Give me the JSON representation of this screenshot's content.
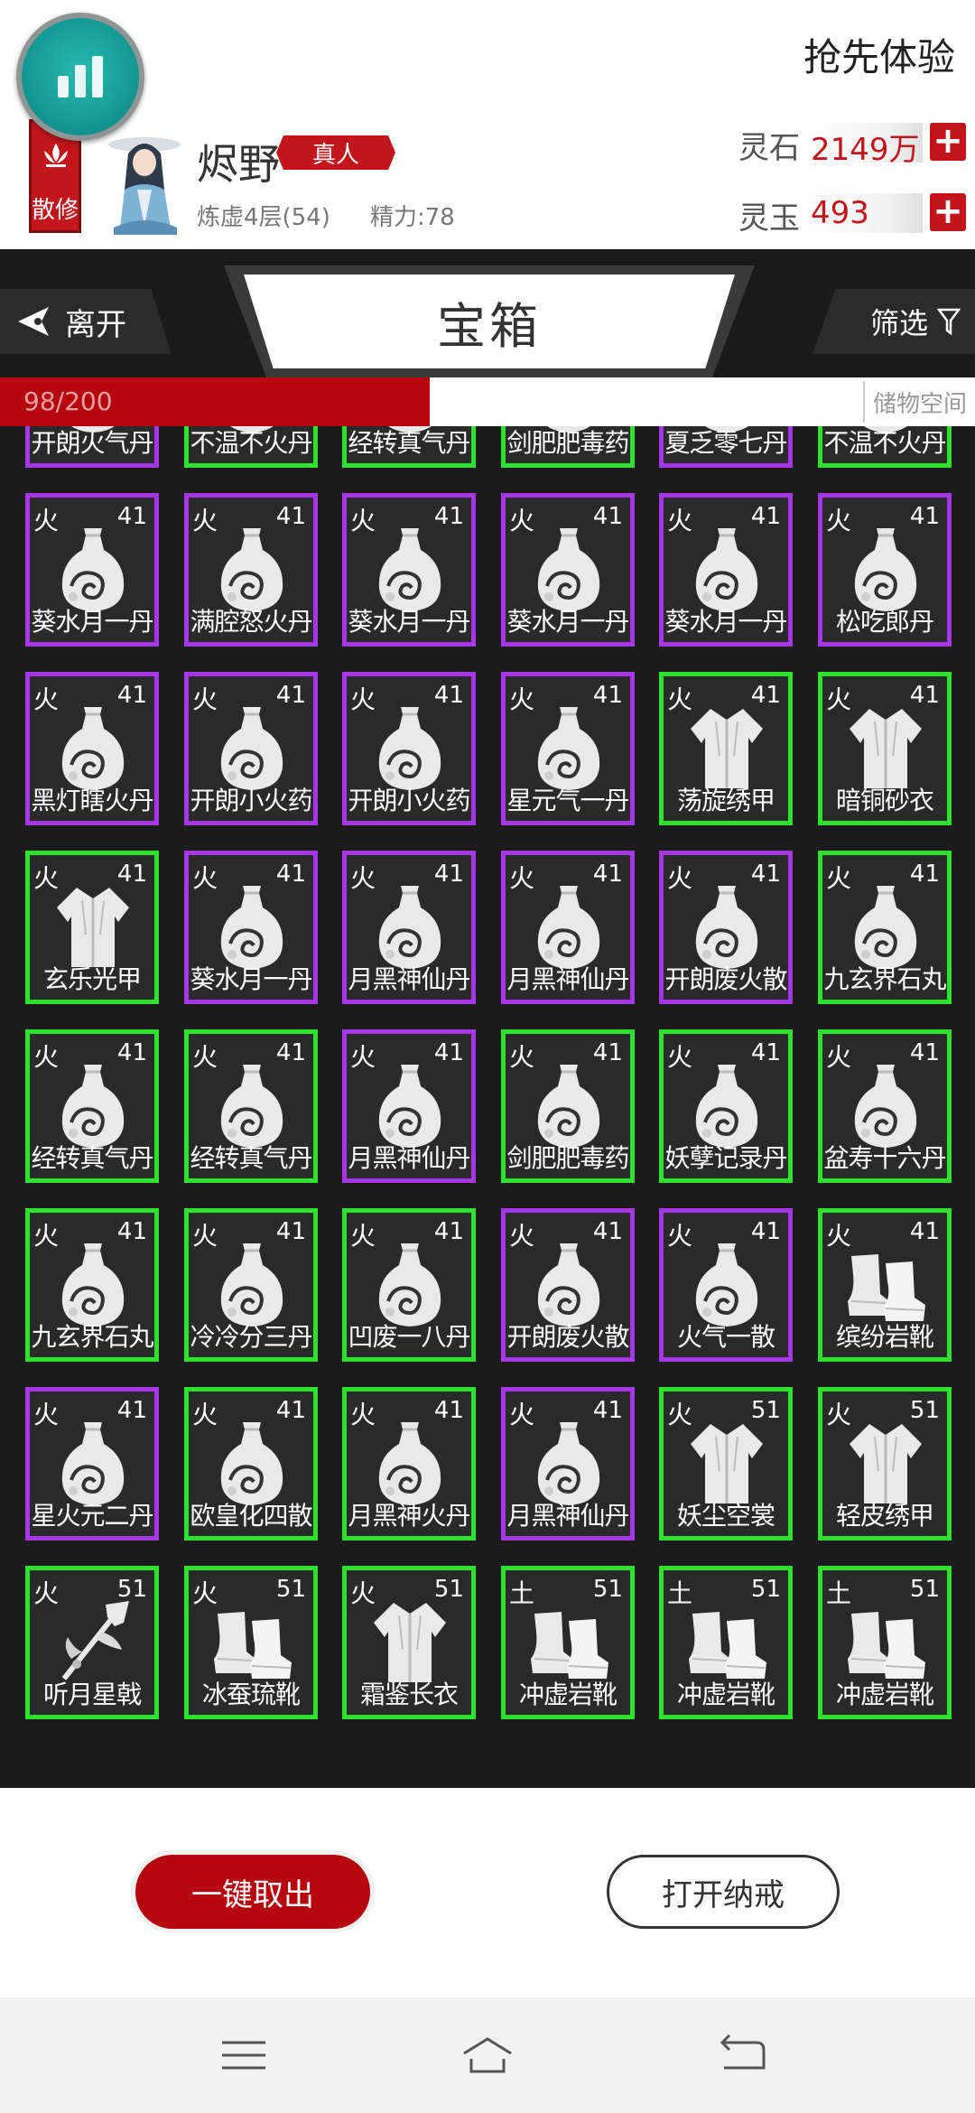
{
  "header": {
    "early_access": "抢先体验",
    "sect_badge": "散修",
    "player": {
      "name": "烬野",
      "realm_tag": "真人",
      "realm_level": "炼虚4层(54)",
      "stamina": "精力:78"
    },
    "currencies": [
      {
        "label": "灵石",
        "value": "2149万",
        "add": "+"
      },
      {
        "label": "灵玉",
        "value": "493",
        "add": "+"
      }
    ]
  },
  "tabs": {
    "leave": "离开",
    "title": "宝箱",
    "filter": "筛选"
  },
  "capacity": {
    "count": "98/200",
    "used": 98,
    "total": 200,
    "storage_label": "储物空间"
  },
  "colors": {
    "accent_red": "#b5070d",
    "rare_green": "#2fe12f",
    "epic_purple": "#a637e8"
  },
  "items": [
    {
      "elem": "",
      "lvl": "",
      "name": "开朗火气丹",
      "rarity": "purple",
      "icon": "pill-bottle-icon"
    },
    {
      "elem": "",
      "lvl": "",
      "name": "不温不火丹",
      "rarity": "green",
      "icon": "pill-bottle-icon"
    },
    {
      "elem": "",
      "lvl": "",
      "name": "经转真气丹",
      "rarity": "green",
      "icon": "pill-bottle-icon"
    },
    {
      "elem": "",
      "lvl": "",
      "name": "剑肥肥毒药",
      "rarity": "green",
      "icon": "pill-bottle-icon"
    },
    {
      "elem": "",
      "lvl": "",
      "name": "夏乏零七丹",
      "rarity": "purple",
      "icon": "pill-bottle-icon"
    },
    {
      "elem": "",
      "lvl": "",
      "name": "不温不火丹",
      "rarity": "green",
      "icon": "pill-bottle-icon"
    },
    {
      "elem": "火",
      "lvl": "41",
      "name": "葵水月一丹",
      "rarity": "purple",
      "icon": "pill-bottle-icon"
    },
    {
      "elem": "火",
      "lvl": "41",
      "name": "满腔怒火丹",
      "rarity": "purple",
      "icon": "pill-bottle-icon"
    },
    {
      "elem": "火",
      "lvl": "41",
      "name": "葵水月一丹",
      "rarity": "purple",
      "icon": "pill-bottle-icon"
    },
    {
      "elem": "火",
      "lvl": "41",
      "name": "葵水月一丹",
      "rarity": "purple",
      "icon": "pill-bottle-icon"
    },
    {
      "elem": "火",
      "lvl": "41",
      "name": "葵水月一丹",
      "rarity": "purple",
      "icon": "pill-bottle-icon"
    },
    {
      "elem": "火",
      "lvl": "41",
      "name": "松吃郎丹",
      "rarity": "purple",
      "icon": "pill-bottle-icon"
    },
    {
      "elem": "火",
      "lvl": "41",
      "name": "黑灯瞎火丹",
      "rarity": "purple",
      "icon": "pill-bottle-icon"
    },
    {
      "elem": "火",
      "lvl": "41",
      "name": "开朗小火药",
      "rarity": "purple",
      "icon": "pill-bottle-icon"
    },
    {
      "elem": "火",
      "lvl": "41",
      "name": "开朗小火药",
      "rarity": "purple",
      "icon": "pill-bottle-icon"
    },
    {
      "elem": "火",
      "lvl": "41",
      "name": "星元气一丹",
      "rarity": "purple",
      "icon": "pill-bottle-icon"
    },
    {
      "elem": "火",
      "lvl": "41",
      "name": "荡旋绣甲",
      "rarity": "green",
      "icon": "robe-icon"
    },
    {
      "elem": "火",
      "lvl": "41",
      "name": "暗铜砂衣",
      "rarity": "green",
      "icon": "robe-icon"
    },
    {
      "elem": "火",
      "lvl": "41",
      "name": "玄乐光甲",
      "rarity": "green",
      "icon": "robe-icon"
    },
    {
      "elem": "火",
      "lvl": "41",
      "name": "葵水月一丹",
      "rarity": "purple",
      "icon": "pill-bottle-icon"
    },
    {
      "elem": "火",
      "lvl": "41",
      "name": "月黑神仙丹",
      "rarity": "purple",
      "icon": "pill-bottle-icon"
    },
    {
      "elem": "火",
      "lvl": "41",
      "name": "月黑神仙丹",
      "rarity": "purple",
      "icon": "pill-bottle-icon"
    },
    {
      "elem": "火",
      "lvl": "41",
      "name": "开朗废火散",
      "rarity": "purple",
      "icon": "pill-bottle-icon"
    },
    {
      "elem": "火",
      "lvl": "41",
      "name": "九玄界石丸",
      "rarity": "green",
      "icon": "pill-bottle-icon"
    },
    {
      "elem": "火",
      "lvl": "41",
      "name": "经转真气丹",
      "rarity": "green",
      "icon": "pill-bottle-icon"
    },
    {
      "elem": "火",
      "lvl": "41",
      "name": "经转真气丹",
      "rarity": "green",
      "icon": "pill-bottle-icon"
    },
    {
      "elem": "火",
      "lvl": "41",
      "name": "月黑神仙丹",
      "rarity": "purple",
      "icon": "pill-bottle-icon"
    },
    {
      "elem": "火",
      "lvl": "41",
      "name": "剑肥肥毒药",
      "rarity": "green",
      "icon": "pill-bottle-icon"
    },
    {
      "elem": "火",
      "lvl": "41",
      "name": "妖孽记录丹",
      "rarity": "green",
      "icon": "pill-bottle-icon"
    },
    {
      "elem": "火",
      "lvl": "41",
      "name": "盆寿十六丹",
      "rarity": "green",
      "icon": "pill-bottle-icon"
    },
    {
      "elem": "火",
      "lvl": "41",
      "name": "九玄界石丸",
      "rarity": "green",
      "icon": "pill-bottle-icon"
    },
    {
      "elem": "火",
      "lvl": "41",
      "name": "冷冷分三丹",
      "rarity": "green",
      "icon": "pill-bottle-icon"
    },
    {
      "elem": "火",
      "lvl": "41",
      "name": "凹废一八丹",
      "rarity": "green",
      "icon": "pill-bottle-icon"
    },
    {
      "elem": "火",
      "lvl": "41",
      "name": "开朗废火散",
      "rarity": "purple",
      "icon": "pill-bottle-icon"
    },
    {
      "elem": "火",
      "lvl": "41",
      "name": "火气一散",
      "rarity": "purple",
      "icon": "pill-bottle-icon"
    },
    {
      "elem": "火",
      "lvl": "41",
      "name": "缤纷岩靴",
      "rarity": "green",
      "icon": "boots-icon"
    },
    {
      "elem": "火",
      "lvl": "41",
      "name": "星火元二丹",
      "rarity": "purple",
      "icon": "pill-bottle-icon"
    },
    {
      "elem": "火",
      "lvl": "41",
      "name": "欧皇化四散",
      "rarity": "green",
      "icon": "pill-bottle-icon"
    },
    {
      "elem": "火",
      "lvl": "41",
      "name": "月黑神火丹",
      "rarity": "green",
      "icon": "pill-bottle-icon"
    },
    {
      "elem": "火",
      "lvl": "41",
      "name": "月黑神仙丹",
      "rarity": "purple",
      "icon": "pill-bottle-icon"
    },
    {
      "elem": "火",
      "lvl": "51",
      "name": "妖尘空裳",
      "rarity": "green",
      "icon": "robe-icon"
    },
    {
      "elem": "火",
      "lvl": "51",
      "name": "轻皮绣甲",
      "rarity": "green",
      "icon": "robe-icon"
    },
    {
      "elem": "火",
      "lvl": "51",
      "name": "听月星戟",
      "rarity": "green",
      "icon": "halberd-icon"
    },
    {
      "elem": "火",
      "lvl": "51",
      "name": "冰蚕琉靴",
      "rarity": "green",
      "icon": "boots-icon"
    },
    {
      "elem": "火",
      "lvl": "51",
      "name": "霜鉴长衣",
      "rarity": "green",
      "icon": "robe-icon"
    },
    {
      "elem": "土",
      "lvl": "51",
      "name": "冲虚岩靴",
      "rarity": "green",
      "icon": "boots-icon"
    },
    {
      "elem": "土",
      "lvl": "51",
      "name": "冲虚岩靴",
      "rarity": "green",
      "icon": "boots-icon"
    },
    {
      "elem": "土",
      "lvl": "51",
      "name": "冲虚岩靴",
      "rarity": "green",
      "icon": "boots-icon"
    }
  ],
  "actions": {
    "take_all": "一键取出",
    "open_ring": "打开纳戒"
  }
}
